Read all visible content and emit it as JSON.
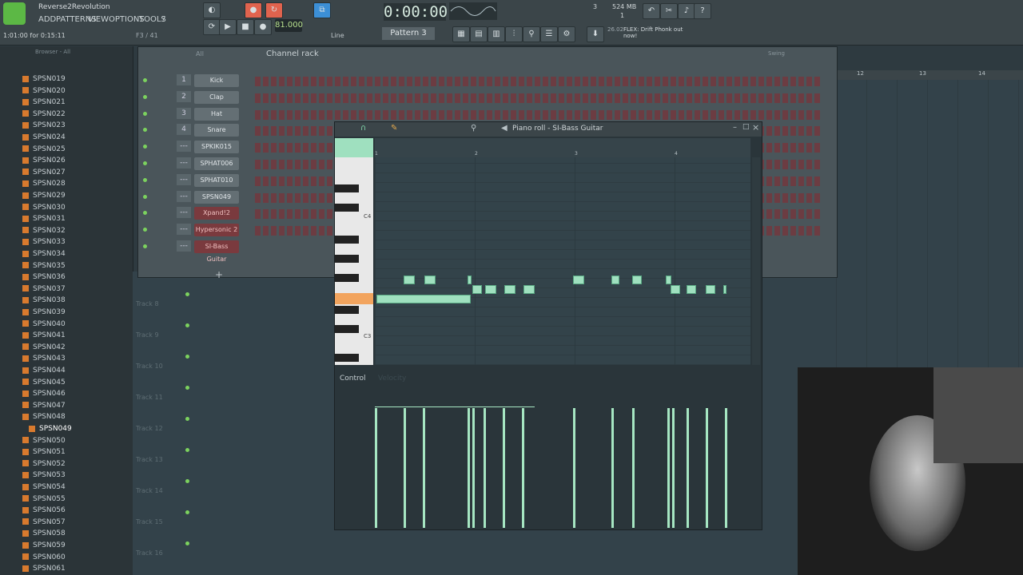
{
  "window": {
    "title": "Reverse2Revolution",
    "time_hint": "1:01:00 for 0:15:11",
    "pos": "F3 / 41"
  },
  "menu": [
    "ADD",
    "PATTERNS",
    "VIEW",
    "OPTIONS",
    "TOOLS",
    "?"
  ],
  "transport": {
    "time": "0:00:00",
    "tempo": "81.000",
    "pattern": "Pattern 3",
    "snap": "Line",
    "cpu": "3",
    "mem": "524 MB",
    "poly": "1"
  },
  "news": {
    "date": "26.02",
    "text": "FLEX: Drift Phonk out now!"
  },
  "browser": {
    "header": "Browser - All",
    "items": [
      "SPSN019",
      "SPSN020",
      "SPSN021",
      "SPSN022",
      "SPSN023",
      "SPSN024",
      "SPSN025",
      "SPSN026",
      "SPSN027",
      "SPSN028",
      "SPSN029",
      "SPSN030",
      "SPSN031",
      "SPSN032",
      "SPSN033",
      "SPSN034",
      "SPSN035",
      "SPSN036",
      "SPSN037",
      "SPSN038",
      "SPSN039",
      "SPSN040",
      "SPSN041",
      "SPSN042",
      "SPSN043",
      "SPSN044",
      "SPSN045",
      "SPSN046",
      "SPSN047",
      "SPSN048",
      "SPSN049",
      "SPSN050",
      "SPSN051",
      "SPSN052",
      "SPSN053",
      "SPSN054",
      "SPSN055",
      "SPSN056",
      "SPSN057",
      "SPSN058",
      "SPSN059",
      "SPSN060",
      "SPSN061"
    ],
    "selected": "SPSN049"
  },
  "channel_rack": {
    "title": "Channel rack",
    "filter": "All",
    "swing": "Swing",
    "channels": [
      {
        "num": "1",
        "name": "Kick"
      },
      {
        "num": "2",
        "name": "Clap"
      },
      {
        "num": "3",
        "name": "Hat"
      },
      {
        "num": "4",
        "name": "Snare"
      },
      {
        "num": "---",
        "name": "SPKIK015"
      },
      {
        "num": "---",
        "name": "SPHAT006"
      },
      {
        "num": "---",
        "name": "SPHAT010"
      },
      {
        "num": "---",
        "name": "SPSN049"
      },
      {
        "num": "---",
        "name": "Xpand!2"
      },
      {
        "num": "---",
        "name": "Hypersonic 2"
      },
      {
        "num": "---",
        "name": "SI-Bass Guitar"
      }
    ]
  },
  "playlist": {
    "bar_numbers": [
      "12",
      "13",
      "14"
    ],
    "tracks": [
      "Track 8",
      "Track 9",
      "Track 10",
      "Track 11",
      "Track 12",
      "Track 13",
      "Track 14",
      "Track 15",
      "Track 16"
    ]
  },
  "piano_roll": {
    "title": "Piano roll - SI-Bass Guitar",
    "bars": [
      "1",
      "2",
      "3",
      "4"
    ],
    "key_labels": [
      "C4",
      "C3"
    ],
    "control": "Control",
    "control_sub": "Velocity"
  }
}
